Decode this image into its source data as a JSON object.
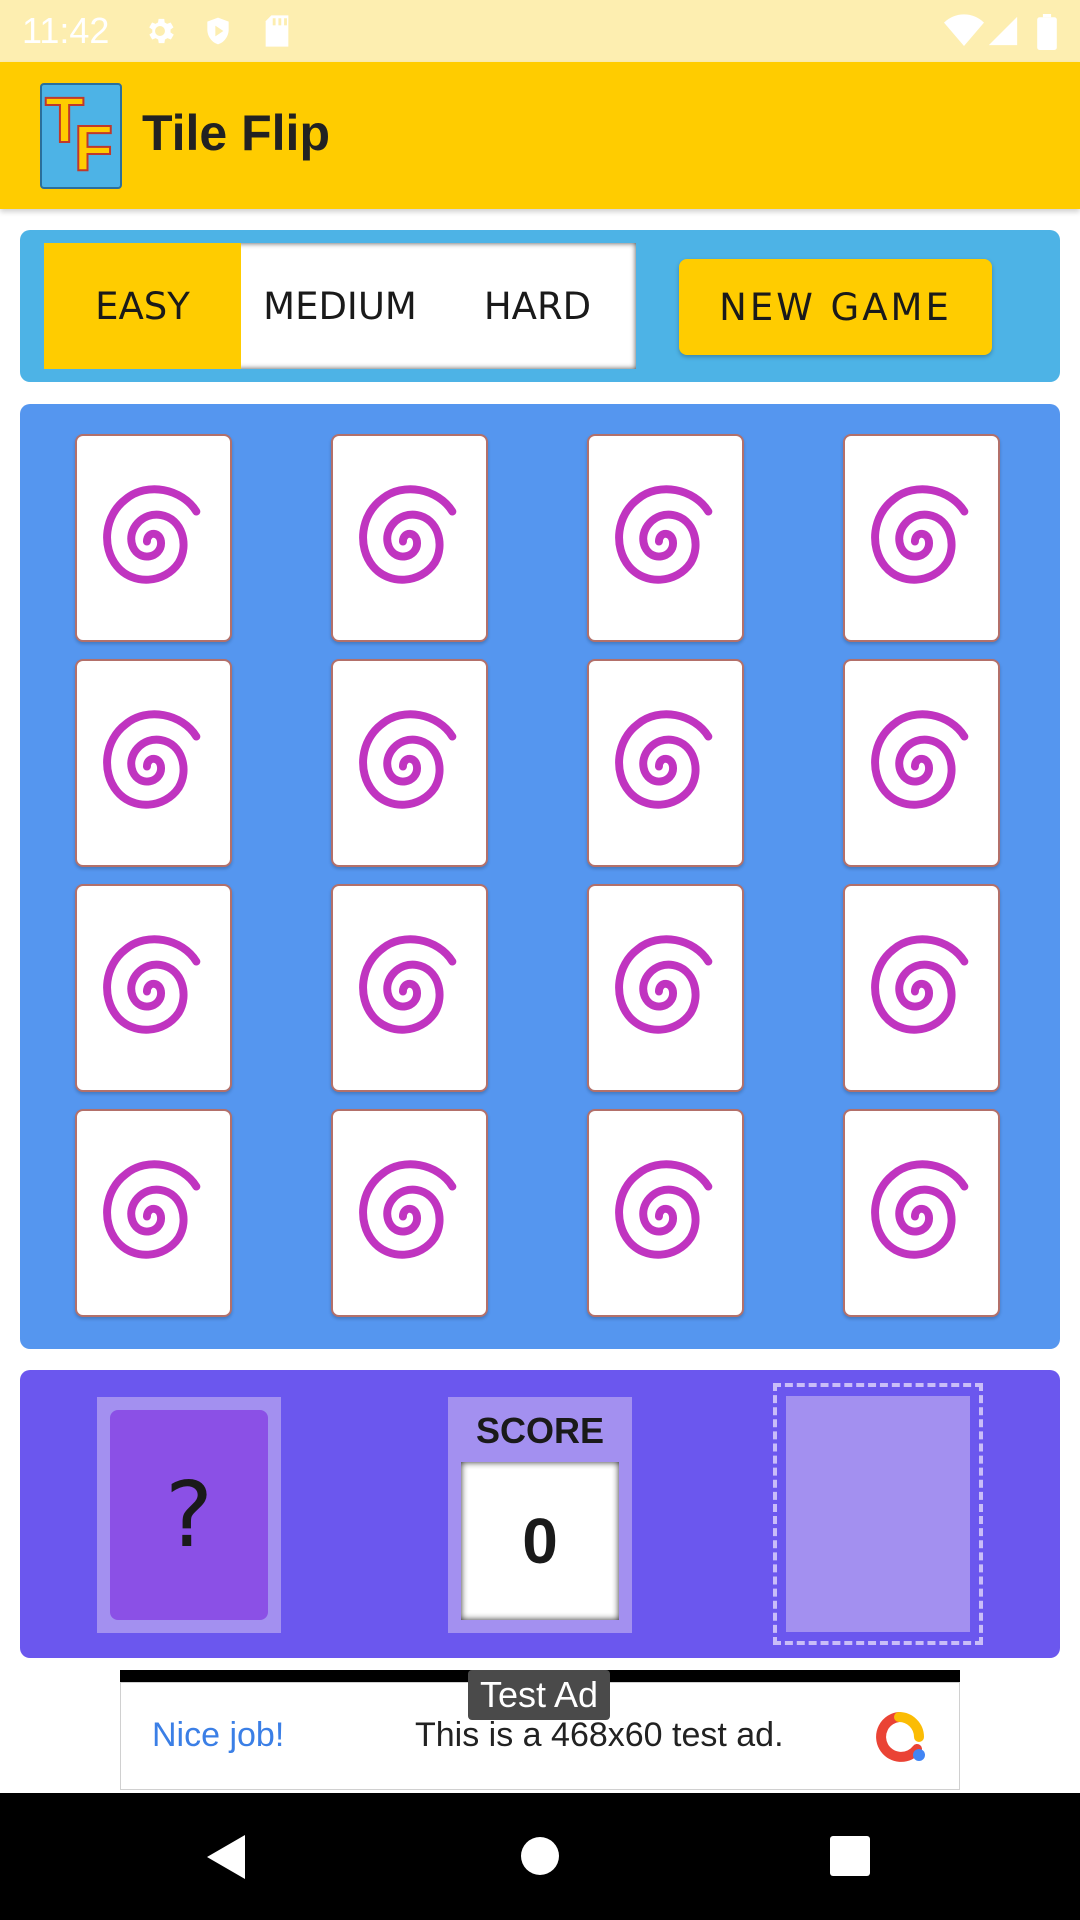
{
  "status_bar": {
    "time": "11:42",
    "icons": [
      "gear-icon",
      "shield-icon",
      "sd-card-icon",
      "wifi-icon",
      "signal-icon",
      "battery-icon"
    ]
  },
  "app_bar": {
    "logo_letters": [
      "T",
      "F"
    ],
    "title": "Tile Flip"
  },
  "controls": {
    "difficulty": [
      "EASY",
      "MEDIUM",
      "HARD"
    ],
    "selected_difficulty": "EASY",
    "new_game_label": "NEW GAME"
  },
  "board": {
    "rows": 4,
    "cols": 4,
    "tile_icon": "spiral-icon",
    "tile_color": "#c034c0"
  },
  "panel": {
    "current_card": "?",
    "score_label": "SCORE",
    "score_value": "0"
  },
  "ad": {
    "tag": "Test Ad",
    "headline": "Nice job!",
    "text": "This is a 468x60 test ad."
  },
  "nav_bar": {
    "icons": [
      "back-icon",
      "home-icon",
      "recents-icon"
    ]
  },
  "colors": {
    "accent": "#ffcc00",
    "board": "#5596ef",
    "panel": "#6b57ee",
    "controls": "#4db3e6"
  }
}
